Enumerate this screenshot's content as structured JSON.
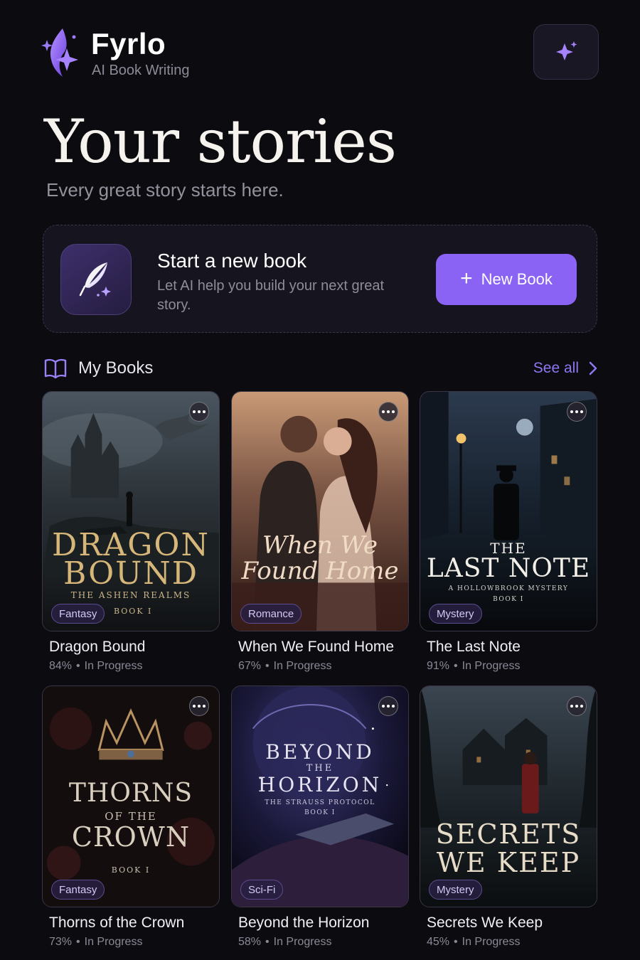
{
  "brand": {
    "name": "Fyrlo",
    "tagline": "AI Book Writing"
  },
  "page": {
    "title": "Your stories",
    "subtitle": "Every great story starts here."
  },
  "new_book_card": {
    "title": "Start a new book",
    "description": "Let AI help you build your next great story.",
    "button_label": "New Book",
    "button_icon": "plus-icon",
    "icon": "quill-icon"
  },
  "section": {
    "title": "My Books",
    "see_all_label": "See all",
    "icon": "open-book-icon"
  },
  "colors": {
    "accent": "#8a63f4",
    "background": "#0c0b10",
    "card": "#16141e"
  },
  "books": [
    {
      "title": "Dragon Bound",
      "progress": "84%",
      "status": "In Progress",
      "genre": "Fantasy",
      "cover": {
        "line1": "DRAGON",
        "line2": "BOUND",
        "line3": "THE ASHEN REALMS",
        "line4": "BOOK I"
      }
    },
    {
      "title": "When We Found Home",
      "progress": "67%",
      "status": "In Progress",
      "genre": "Romance",
      "cover": {
        "line1": "When We",
        "line2": "Found Home"
      }
    },
    {
      "title": "The Last Note",
      "progress": "91%",
      "status": "In Progress",
      "genre": "Mystery",
      "cover": {
        "line1": "THE",
        "line2": "LAST NOTE",
        "line3": "A HOLLOWBROOK MYSTERY",
        "line4": "BOOK I"
      }
    },
    {
      "title": "Thorns of the Crown",
      "progress": "73%",
      "status": "In Progress",
      "genre": "Fantasy",
      "cover": {
        "line1": "THORNS",
        "line2": "OF THE",
        "line3": "CROWN",
        "line4": "BOOK I"
      }
    },
    {
      "title": "Beyond the Horizon",
      "progress": "58%",
      "status": "In Progress",
      "genre": "Sci-Fi",
      "cover": {
        "line1": "BEYOND",
        "line2": "THE",
        "line3": "HORIZON",
        "line4": "THE STRAUSS PROTOCOL",
        "line5": "BOOK I"
      }
    },
    {
      "title": "Secrets We Keep",
      "progress": "45%",
      "status": "In Progress",
      "genre": "Mystery",
      "cover": {
        "line1": "SECRETS",
        "line2": "WE KEEP"
      }
    }
  ]
}
